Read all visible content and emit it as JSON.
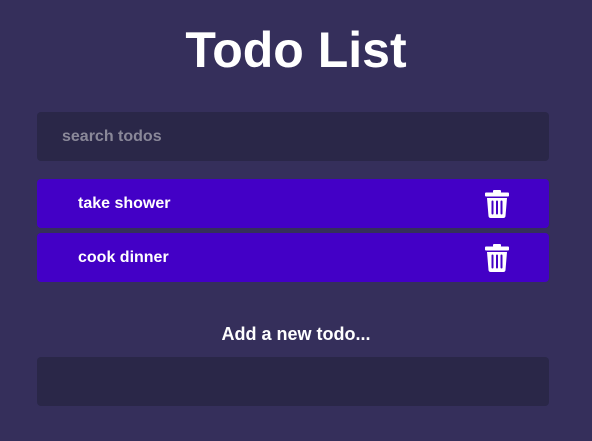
{
  "header": {
    "title": "Todo List"
  },
  "search": {
    "placeholder": "search todos",
    "value": ""
  },
  "todos": [
    {
      "text": "take shower",
      "delete_icon": "trash-icon"
    },
    {
      "text": "cook dinner",
      "delete_icon": "trash-icon"
    }
  ],
  "add": {
    "label": "Add a new todo...",
    "value": ""
  },
  "colors": {
    "background": "#352f5b",
    "input_background": "#2a2748",
    "todo_background": "#4300c6",
    "text": "#ffffff",
    "placeholder": "#8a8899"
  }
}
